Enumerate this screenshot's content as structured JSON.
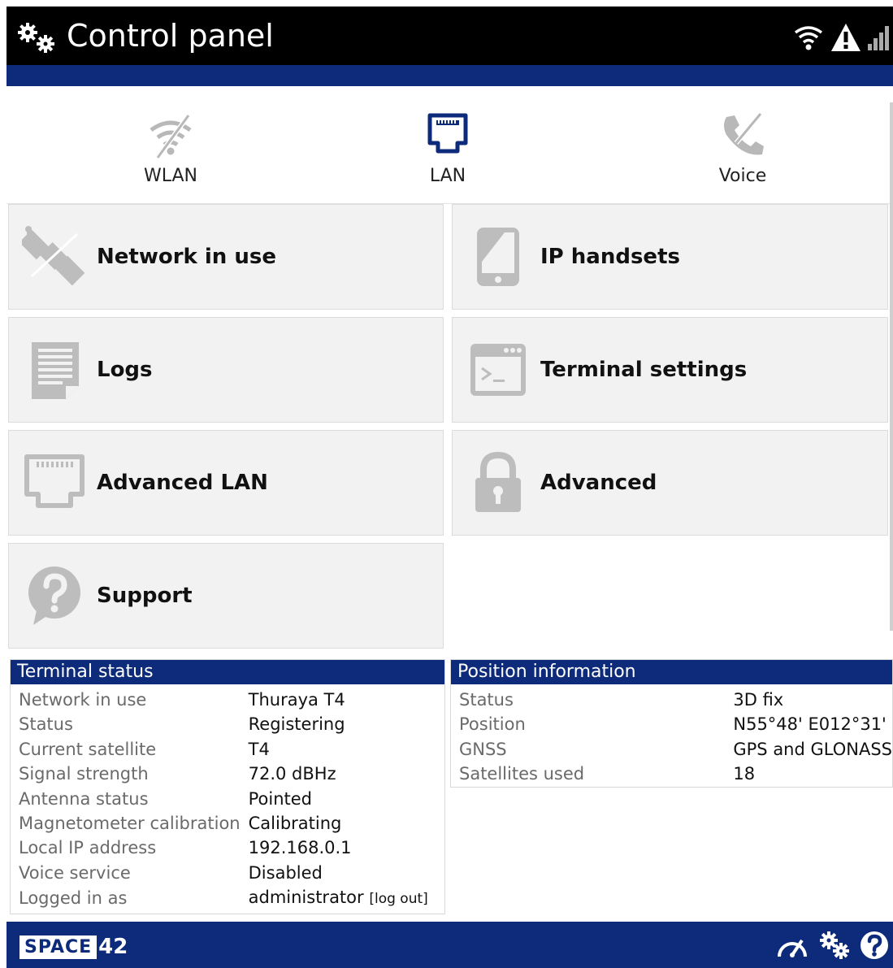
{
  "header": {
    "title": "Control panel"
  },
  "tabs": [
    {
      "label": "WLAN",
      "icon": "wlan-disabled-icon",
      "active": false
    },
    {
      "label": "LAN",
      "icon": "lan-port-icon",
      "active": true
    },
    {
      "label": "Voice",
      "icon": "phone-disabled-icon",
      "active": false
    }
  ],
  "tiles": [
    {
      "label": "Network in use",
      "icon": "satellite-icon"
    },
    {
      "label": "IP handsets",
      "icon": "handset-icon"
    },
    {
      "label": "Logs",
      "icon": "document-icon"
    },
    {
      "label": "Terminal settings",
      "icon": "terminal-icon"
    },
    {
      "label": "Advanced LAN",
      "icon": "ethernet-port-icon"
    },
    {
      "label": "Advanced",
      "icon": "lock-icon"
    },
    {
      "label": "Support",
      "icon": "question-bubble-icon"
    }
  ],
  "terminal_status": {
    "title": "Terminal status",
    "rows": [
      {
        "key": "Network in use",
        "value": "Thuraya T4"
      },
      {
        "key": "Status",
        "value": "Registering"
      },
      {
        "key": "Current satellite",
        "value": "T4"
      },
      {
        "key": "Signal strength",
        "value": "72.0 dBHz"
      },
      {
        "key": "Antenna status",
        "value": "Pointed"
      },
      {
        "key": "Magnetometer calibration",
        "value": "Calibrating"
      },
      {
        "key": "Local IP address",
        "value": "192.168.0.1"
      },
      {
        "key": "Voice service",
        "value": "Disabled"
      },
      {
        "key": "Logged in as",
        "value": "administrator"
      }
    ],
    "logout_label": "[log out]"
  },
  "position_information": {
    "title": "Position information",
    "rows": [
      {
        "key": "Status",
        "value": "3D fix"
      },
      {
        "key": "Position",
        "value": "N55°48' E012°31'"
      },
      {
        "key": "GNSS",
        "value": "GPS and GLONASS"
      },
      {
        "key": "Satellites used",
        "value": "18"
      }
    ]
  },
  "footer": {
    "brand_text": "SPACE",
    "brand_number": "42"
  },
  "colors": {
    "header_bg": "#000000",
    "brand_blue": "#0d2b7a",
    "tile_bg": "#f2f2f2",
    "icon_gray": "#bdbdbd",
    "active_blue": "#0d2b7a"
  }
}
